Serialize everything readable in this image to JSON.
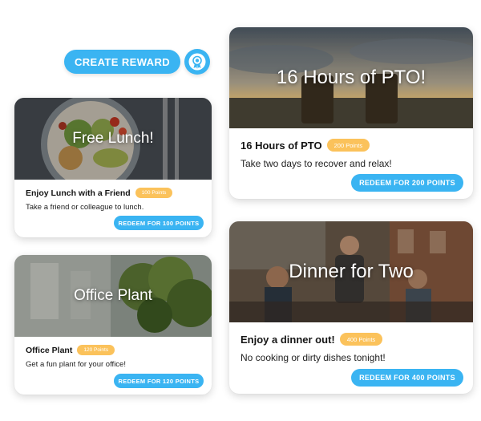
{
  "actions": {
    "create_reward_label": "CREATE REWARD",
    "award_icon": "award-ribbon-icon"
  },
  "rewards": [
    {
      "hero_title": "Free Lunch!",
      "name": "Enjoy Lunch with a Friend",
      "points": "100 Points",
      "description": "Take a friend or colleague to lunch.",
      "redeem_label": "REDEEM FOR 100 POINTS"
    },
    {
      "hero_title": "Office Plant",
      "name": "Office Plant",
      "points": "120 Points",
      "description": "Get a fun plant for your office!",
      "redeem_label": "REDEEM FOR 120 POINTS"
    },
    {
      "hero_title": "16 Hours of PTO!",
      "name": "16 Hours of PTO",
      "points": "200 Points",
      "description": "Take two days to recover and relax!",
      "redeem_label": "REDEEM FOR 200 POINTS"
    },
    {
      "hero_title": "Dinner for Two",
      "name": "Enjoy a dinner out!",
      "points": "400 Points",
      "description": "No cooking or dirty dishes tonight!",
      "redeem_label": "REDEEM FOR 400 POINTS"
    }
  ],
  "colors": {
    "accent": "#3ab4f2",
    "badge": "#fbc25b"
  }
}
